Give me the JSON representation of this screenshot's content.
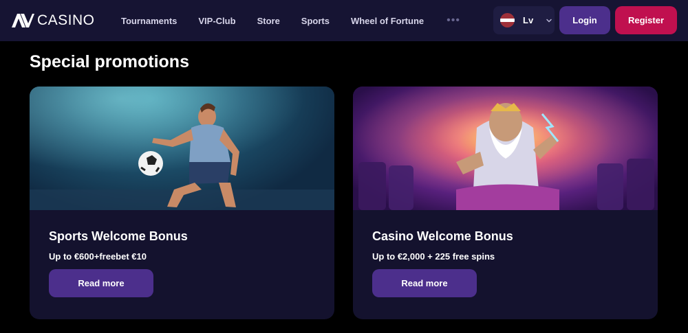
{
  "header": {
    "logo_text": "CASINO",
    "nav": [
      "Tournaments",
      "VIP-Club",
      "Store",
      "Sports",
      "Wheel of Fortune"
    ],
    "more": "•••",
    "language": {
      "label": "Lv",
      "flag_icon": "latvia-flag-icon"
    },
    "login_label": "Login",
    "register_label": "Register"
  },
  "section": {
    "title": "Special promotions"
  },
  "cards": [
    {
      "title": "Sports Welcome Bonus",
      "subtitle": "Up to €600+freebet €10",
      "button": "Read more"
    },
    {
      "title": "Casino Welcome Bonus",
      "subtitle": "Up to €2,000 + 225 free spins",
      "button": "Read more"
    }
  ],
  "colors": {
    "header_bg": "#161433",
    "page_bg": "#000000",
    "card_bg": "#14122e",
    "primary_button": "#4c2f8c",
    "register_button": "#c0104f"
  }
}
